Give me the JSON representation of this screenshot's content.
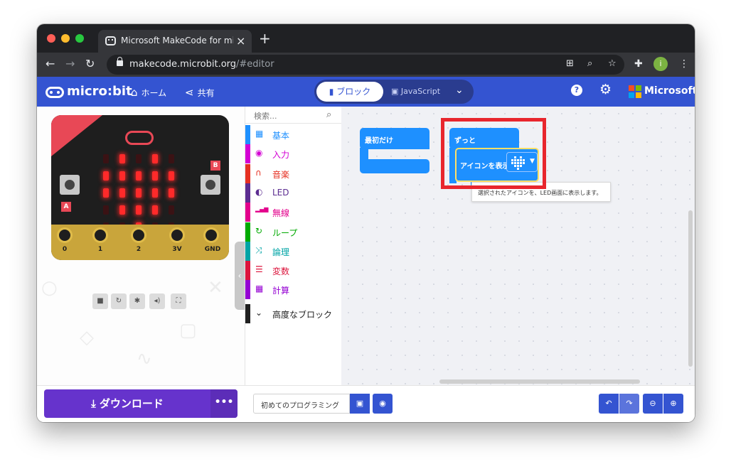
{
  "browser": {
    "tab_title": "Microsoft MakeCode for micro:bit",
    "tab_close": "×",
    "new_tab": "+",
    "url_host": "makecode.microbit.org",
    "url_path": "/#editor",
    "profile_initial": "i"
  },
  "header": {
    "logo_text": "micro:bit",
    "home_label": "ホーム",
    "share_label": "共有",
    "blocks_label": "ブロック",
    "javascript_label": "JavaScript",
    "help_label": "?",
    "brand_label": "Microsoft",
    "brand_colors": [
      "#f25022",
      "#7fba00",
      "#00a4ef",
      "#ffb900"
    ]
  },
  "simulator": {
    "display_pattern": [
      [
        0,
        1,
        0,
        1,
        0
      ],
      [
        1,
        1,
        1,
        1,
        1
      ],
      [
        1,
        1,
        1,
        1,
        1
      ],
      [
        0,
        1,
        1,
        1,
        0
      ],
      [
        0,
        0,
        1,
        0,
        0
      ]
    ],
    "button_a": "A",
    "button_b": "B",
    "pins": [
      "0",
      "1",
      "2",
      "3V",
      "GND"
    ],
    "controls": [
      "stop-icon",
      "restart-icon",
      "debug-icon",
      "mute-icon",
      "fullscreen-icon"
    ]
  },
  "toolbox": {
    "search_placeholder": "検索...",
    "categories": [
      {
        "label": "基本",
        "color": "#1e90ff",
        "icon": "grid-icon"
      },
      {
        "label": "入力",
        "color": "#d400d4",
        "icon": "target-icon"
      },
      {
        "label": "音楽",
        "color": "#e63022",
        "icon": "headphones-icon"
      },
      {
        "label": "LED",
        "color": "#5c2d91",
        "icon": "toggle-icon"
      },
      {
        "label": "無線",
        "color": "#e3008c",
        "icon": "signal-icon"
      },
      {
        "label": "ループ",
        "color": "#00aa00",
        "icon": "loop-icon"
      },
      {
        "label": "論理",
        "color": "#00a4a6",
        "icon": "shuffle-icon"
      },
      {
        "label": "変数",
        "color": "#dc143c",
        "icon": "list-icon"
      },
      {
        "label": "計算",
        "color": "#9400d3",
        "icon": "calculator-icon"
      }
    ],
    "advanced_label": "高度なブロック"
  },
  "workspace": {
    "on_start_label": "最初だけ",
    "forever_label": "ずっと",
    "show_icon_label": "アイコンを表示",
    "tooltip": "選択されたアイコンを、LED画面に表示します。",
    "block_color": "#1e90ff",
    "highlight_color": "#e8262d"
  },
  "footer": {
    "download_label": "ダウンロード",
    "more_label": "•••",
    "project_name": "初めてのプログラミング"
  }
}
